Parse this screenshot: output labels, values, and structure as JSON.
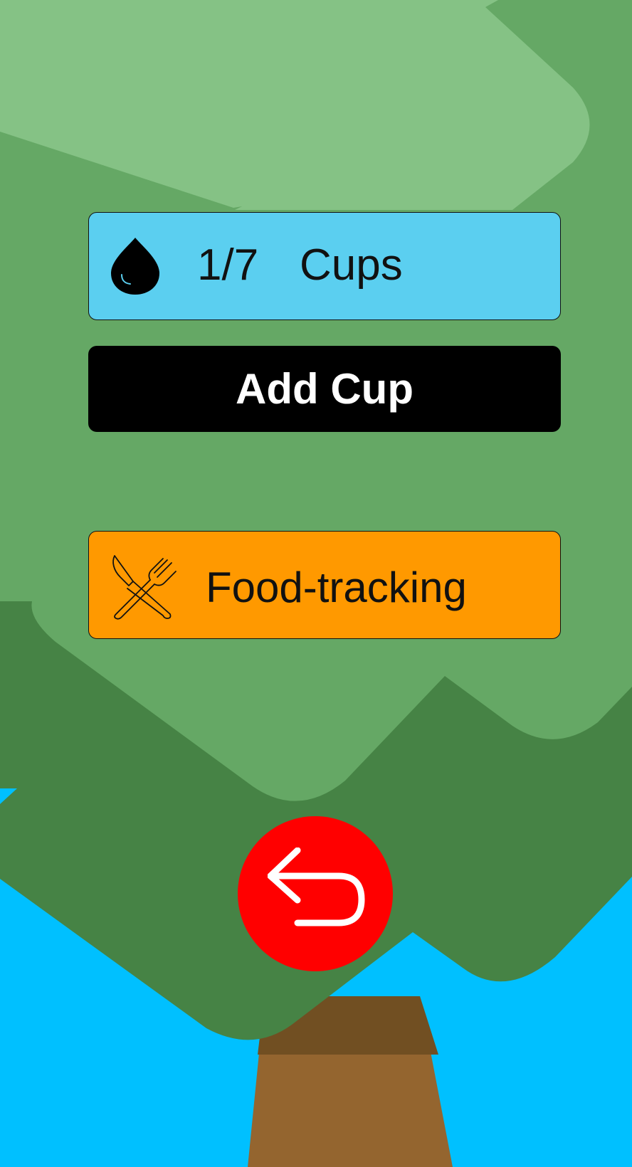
{
  "background": {
    "sky_color": "#00C0FF",
    "trunk_color": "#94652F",
    "trunk_shadow_color": "#714F22",
    "leaf_dark": "#468345",
    "leaf_mid": "#65A865",
    "leaf_light": "#85C285"
  },
  "water": {
    "count": "1/7",
    "unit": "Cups",
    "icon": "water-drop-icon",
    "card_color": "#5BCFF0"
  },
  "add_cup": {
    "label": "Add Cup"
  },
  "food": {
    "label": "Food-tracking",
    "icon": "fork-knife-crossed-icon",
    "card_color": "#FF9900"
  },
  "back": {
    "icon": "undo-arrow-icon",
    "color": "#FF0000"
  }
}
